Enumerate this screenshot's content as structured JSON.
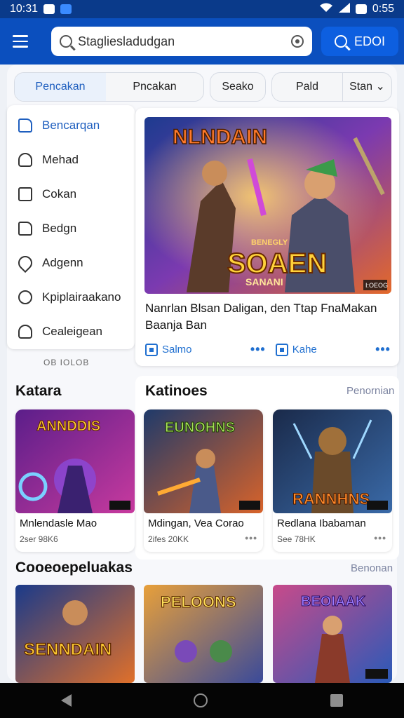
{
  "status_bar": {
    "time_left": "10:31",
    "time_right": "0:55"
  },
  "search": {
    "value": "Stagliesladudgan",
    "button_label": "EDOI"
  },
  "filters": {
    "segment_active": "Pencakan",
    "segment_other": "Pncakan",
    "chip": "Seako",
    "duo_left": "Pald",
    "duo_right": "Stan"
  },
  "sidebar": {
    "items": [
      {
        "label": "Bencarqan",
        "icon": "bookmark-icon"
      },
      {
        "label": "Mehad",
        "icon": "person-icon"
      },
      {
        "label": "Cokan",
        "icon": "list-icon"
      },
      {
        "label": "Bedgn",
        "icon": "folder-icon"
      },
      {
        "label": "Adgenn",
        "icon": "heart-icon"
      },
      {
        "label": "Kpiplairaakano",
        "icon": "target-icon"
      },
      {
        "label": "Cealeigean",
        "icon": "people-icon"
      }
    ],
    "pager": "OB IOLOB"
  },
  "featured": {
    "art_title": "NLNDAIN",
    "art_logo_top": "BENEGLY",
    "art_logo": "SOAEN",
    "art_logo_sub": "SANANI",
    "art_badge": "I:OEOG",
    "title": "Nanrlan Blsan Daligan, den Ttap FnaMakan Baanja Ban",
    "action_left": "Salmo",
    "action_right": "Kahe"
  },
  "section1": {
    "title_left": "Katara",
    "title": "Katinoes",
    "link": "Penornian",
    "cards": [
      {
        "art": "ANNDDIS",
        "title": "Mnlendasle Mao",
        "sub": "2ser 98K6"
      },
      {
        "art": "EUNOHNS",
        "title": "Mdingan, Vea Corao",
        "sub": "2ifes 20KK"
      },
      {
        "art": "RANNHNS",
        "title": "Redlana Ibabaman",
        "sub": "See 78HK"
      }
    ]
  },
  "section2": {
    "title": "Cooeoepeluakas",
    "link": "Benonan",
    "cards": [
      {
        "art": "SENNDAIN"
      },
      {
        "art": "PELOONS"
      },
      {
        "art": "BEOIAAK"
      }
    ]
  },
  "colors": {
    "appbar": "#0b4fbe",
    "accent": "#1f5fbf",
    "statusbar": "#0a3a8a"
  }
}
